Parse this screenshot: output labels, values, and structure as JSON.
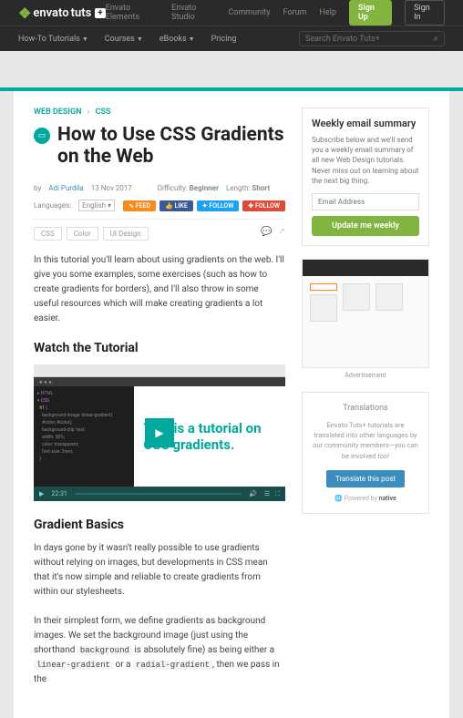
{
  "topbar": {
    "logo_brand": "envato",
    "logo_sub": "tuts",
    "logo_plus": "+",
    "links": [
      "Envato Elements",
      "Envato Studio",
      "Community",
      "Forum",
      "Help"
    ],
    "signup": "Sign Up",
    "signin": "Sign In"
  },
  "nav": {
    "items": [
      {
        "label": "How-To Tutorials",
        "caret": true,
        "active": true
      },
      {
        "label": "Courses",
        "caret": true
      },
      {
        "label": "eBooks",
        "caret": true
      },
      {
        "label": "Pricing",
        "caret": false
      }
    ],
    "search_placeholder": "Search Envato Tuts+"
  },
  "breadcrumb": {
    "cat": "WEB DESIGN",
    "sub": "CSS"
  },
  "article": {
    "title": "How to Use CSS Gradients on the Web",
    "by_label": "by",
    "author": "Adi Purdila",
    "date": "13 Nov 2017",
    "difficulty_label": "Difficulty:",
    "difficulty": "Beginner",
    "length_label": "Length:",
    "length": "Short",
    "languages_label": "Languages:",
    "language": "English",
    "tags": [
      "CSS",
      "Color",
      "UI Design"
    ],
    "intro": "In this tutorial you'll learn about using gradients on the web. I'll give you some examples, some exercises (such as how to create gradients for borders), and I'll also throw in some useful resources which will make creating gradients a lot easier.",
    "h2_watch": "Watch the Tutorial",
    "video_headline": "This is a tutorial on CSS gradients.",
    "video_time": "22:31",
    "h2_basics": "Gradient Basics",
    "p_basics1": "In days gone by it wasn't really possible to use gradients without relying on images, but developments in CSS mean that it's now simple and reliable to create gradients from within our stylesheets.",
    "p_basics2_a": "In their simplest form, we define gradients as background images. We set the background image (just using the shorthand ",
    "p_basics2_code1": "background",
    "p_basics2_b": " is absolutely fine) as being either a ",
    "p_basics2_code2": "linear-gradient",
    "p_basics2_c": " or a ",
    "p_basics2_code3": "radial-gradient",
    "p_basics2_d": ", then we pass in the"
  },
  "badges": {
    "feed": "FEED",
    "like": "LIKE",
    "follow": "FOLLOW",
    "gfollow": "FOLLOW"
  },
  "sidebar": {
    "weekly_title": "Weekly email summary",
    "weekly_text": "Subscribe below and we'll send you a weekly email summary of all new Web Design tutorials. Never miss out on learning about the next big thing.",
    "email_placeholder": "Email Address",
    "update_btn": "Update me weekly",
    "ad_label": "Advertisement",
    "trans_title": "Translations",
    "trans_text": "Envato Tuts+ tutorials are translated into other languages by our community members—you can be involved too!",
    "trans_btn": "Translate this post",
    "powered": "Powered by",
    "powered_brand": "native"
  }
}
